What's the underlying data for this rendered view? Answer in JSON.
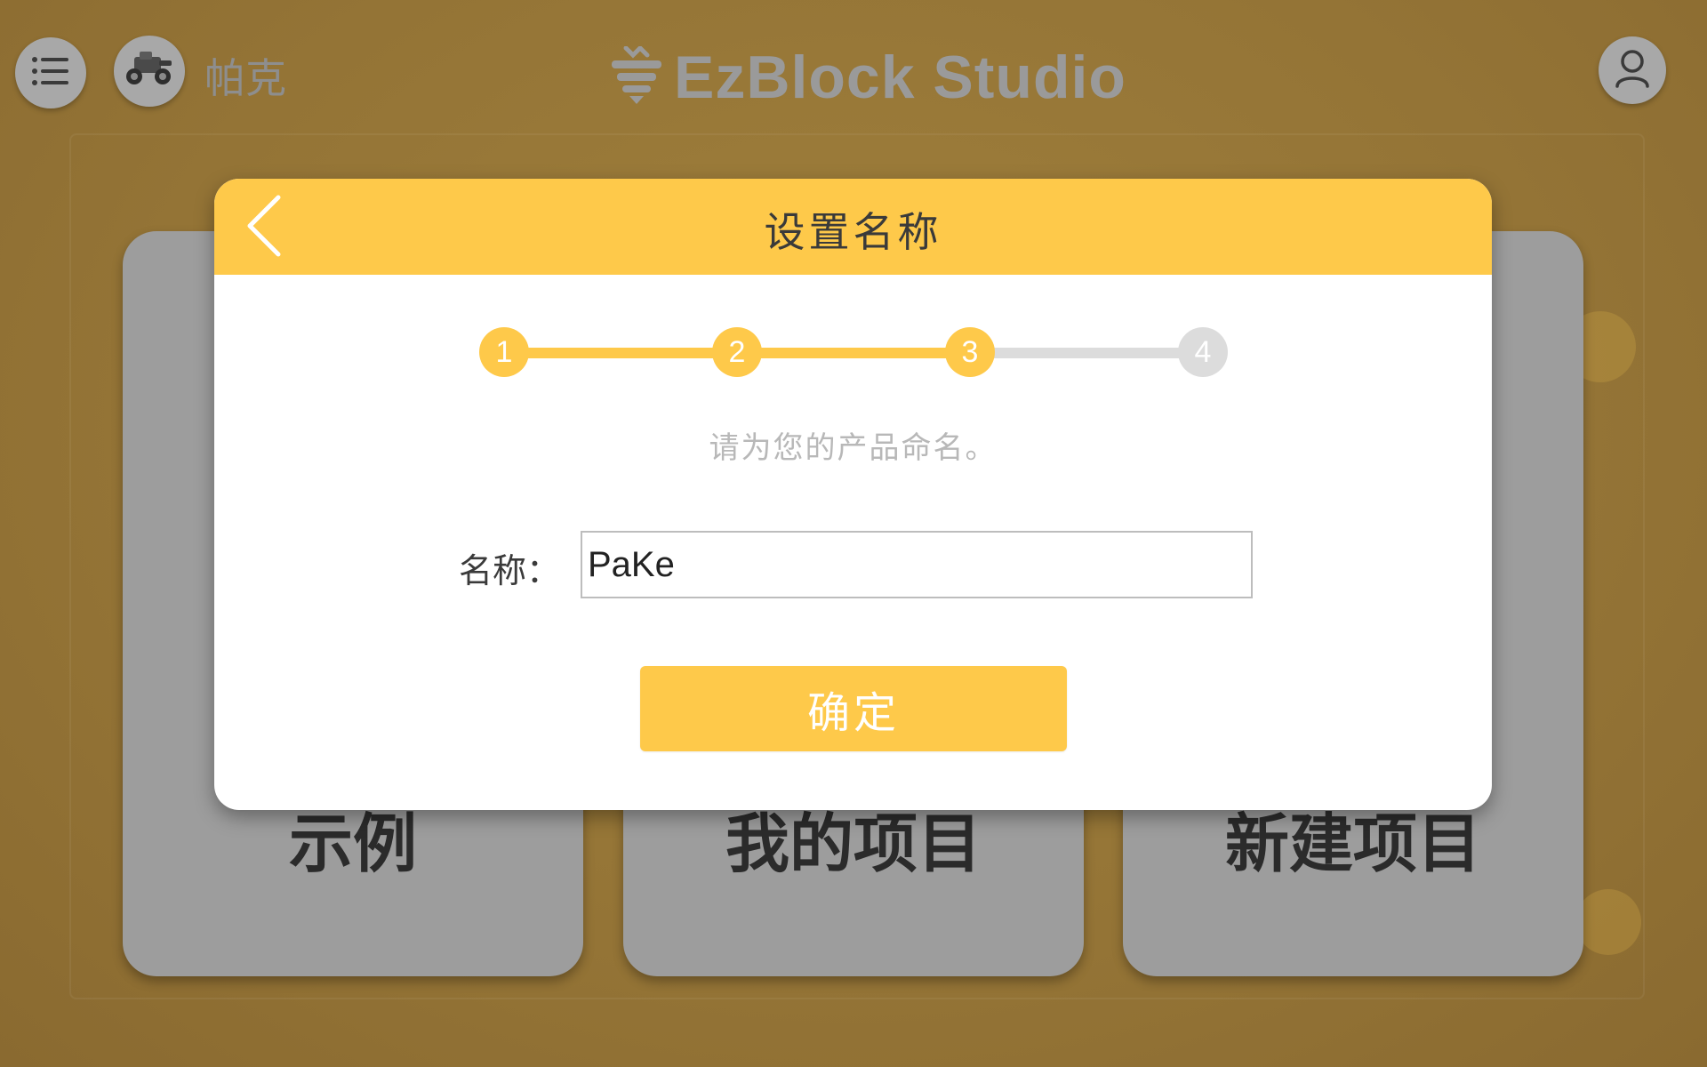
{
  "header": {
    "product_name": "帕克",
    "brand_title": "EzBlock Studio",
    "menu_icon": "menu-list-icon",
    "product_icon": "robot-car-icon",
    "user_icon": "user-icon"
  },
  "cards": [
    {
      "label": "示例"
    },
    {
      "label": "我的项目"
    },
    {
      "label": "新建项目"
    }
  ],
  "dialog": {
    "title": "设置名称",
    "back_icon": "chevron-left-icon",
    "steps": [
      "1",
      "2",
      "3",
      "4"
    ],
    "current_step": 3,
    "hint": "请为您的产品命名。",
    "name_label": "名称：",
    "name_value": "PaKe",
    "confirm_label": "确定"
  },
  "colors": {
    "accent": "#fec94a",
    "inactive": "#dcdcdc",
    "overlay_bg": "#9a7b3a"
  }
}
